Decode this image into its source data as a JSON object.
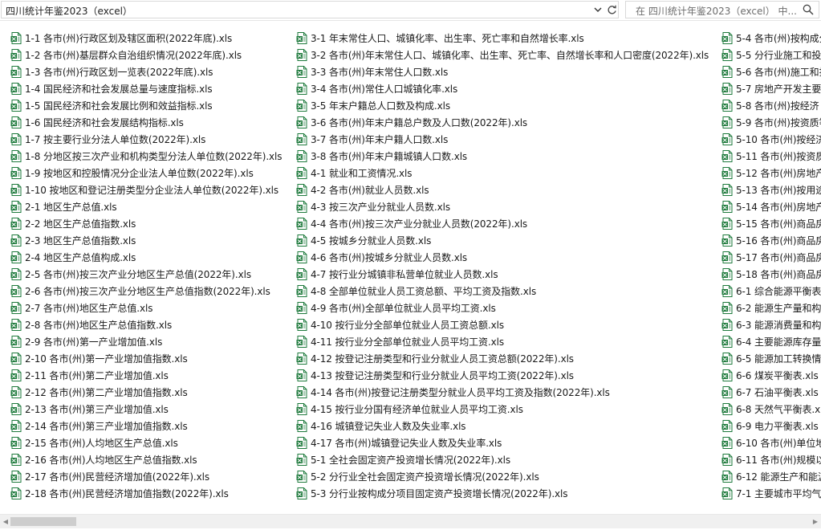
{
  "address_bar": {
    "path": "四川统计年鉴2023（excel）"
  },
  "search": {
    "placeholder": "在 四川统计年鉴2023（excel） 中..."
  },
  "columns": [
    [
      "1-1 各市(州)行政区划及辖区面积(2022年底).xls",
      "1-2 各市(州)基层群众自治组织情况(2022年底).xls",
      "1-3 各市(州)行政区划一览表(2022年底).xls",
      "1-4 国民经济和社会发展总量与速度指标.xls",
      "1-5 国民经济和社会发展比例和效益指标.xls",
      "1-6 国民经济和社会发展结构指标.xls",
      "1-7 按主要行业分法人单位数(2022年).xls",
      "1-8 分地区按三次产业和机构类型分法人单位数(2022年).xls",
      "1-9 按地区和控股情况分企业法人单位数(2022年).xls",
      "1-10 按地区和登记注册类型分企业法人单位数(2022年).xls",
      "2-1 地区生产总值.xls",
      "2-2 地区生产总值指数.xls",
      "2-3 地区生产总值指数.xls",
      "2-4 地区生产总值构成.xls",
      "2-5 各市(州)按三次产业分地区生产总值(2022年).xls",
      "2-6 各市(州)按三次产业分地区生产总值指数(2022年).xls",
      "2-7 各市(州)地区生产总值.xls",
      "2-8 各市(州)地区生产总值指数.xls",
      "2-9 各市(州)第一产业增加值.xls",
      "2-10 各市(州)第一产业增加值指数.xls",
      "2-11 各市(州)第二产业增加值.xls",
      "2-12 各市(州)第二产业增加值指数.xls",
      "2-13 各市(州)第三产业增加值.xls",
      "2-14 各市(州)第三产业增加值指数.xls",
      "2-15 各市(州)人均地区生产总值.xls",
      "2-16 各市(州)人均地区生产总值指数.xls",
      "2-17 各市(州)民营经济增加值(2022年).xls",
      "2-18 各市(州)民营经济增加值指数(2022年).xls"
    ],
    [
      "3-1 年末常住人口、城镇化率、出生率、死亡率和自然增长率.xls",
      "3-2 各市(州)年末常住人口、城镇化率、出生率、死亡率、自然增长率和人口密度(2022年).xls",
      "3-3 各市(州)年末常住人口数.xls",
      "3-4 各市(州)常住人口城镇化率.xls",
      "3-5 年末户籍总人口数及构成.xls",
      "3-6 各市(州)年末户籍总户数及人口数(2022年).xls",
      "3-7 各市(州)年末户籍人口数.xls",
      "3-8 各市(州)年末户籍城镇人口数.xls",
      "4-1 就业和工资情况.xls",
      "4-2 各市(州)就业人员数.xls",
      "4-3 按三次产业分就业人员数.xls",
      "4-4 各市(州)按三次产业分就业人员数(2022年).xls",
      "4-5 按城乡分就业人员数.xls",
      "4-6 各市(州)按城乡分就业人员数.xls",
      "4-7 按行业分城镇非私营单位就业人员数.xls",
      "4-8 全部单位就业人员工资总额、平均工资及指数.xls",
      "4-9 各市(州)全部单位就业人员平均工资.xls",
      "4-10 按行业分全部单位就业人员工资总额.xls",
      "4-11 按行业分全部单位就业人员平均工资.xls",
      "4-12 按登记注册类型和行业分就业人员工资总额(2022年).xls",
      "4-13 按登记注册类型和行业分就业人员平均工资(2022年).xls",
      "4-14 各市(州)按登记注册类型分就业人员平均工资及指数(2022年).xls",
      "4-15 按行业分国有经济单位就业人员平均工资.xls",
      "4-16 城镇登记失业人数及失业率.xls",
      "4-17 各市(州)城镇登记失业人数及失业率.xls",
      "5-1 全社会固定资产投资增长情况(2022年).xls",
      "5-2 分行业全社会固定资产投资增长情况(2022年).xls",
      "5-3 分行业按构成分项目固定资产投资增长情况(2022年).xls"
    ],
    [
      "5-4 各市(州)按构成分",
      "5-5 分行业施工和投",
      "5-6 各市(州)施工和投",
      "5-7 房地产开发主要",
      "5-8 各市(州)按经济",
      "5-9 各市(州)按资质等",
      "5-10 各市(州)按经济",
      "5-11 各市(州)按资质",
      "5-12 各市(州)房地产",
      "5-13 各市(州)按用途",
      "5-14 各市(州)房地产",
      "5-15 各市(州)商品房",
      "5-16 各市(州)商品房",
      "5-17 各市(州)商品房",
      "5-18 各市(州)商品房",
      "6-1 综合能源平衡表",
      "6-2 能源生产量和构",
      "6-3 能源消费量和构",
      "6-4 主要能源库存量",
      "6-5 能源加工转换情",
      "6-6 煤炭平衡表.xls",
      "6-7 石油平衡表.xls",
      "6-8 天然气平衡表.xl",
      "6-9 电力平衡表.xls",
      "6-10 各市(州)单位地",
      "6-11 各市(州)规模以",
      "6-12 能源生产和能源",
      "7-1 主要城市平均气"
    ]
  ],
  "colors": {
    "icon_green": "#1e7a3c",
    "scroll_thumb": "#cdcdcd"
  }
}
